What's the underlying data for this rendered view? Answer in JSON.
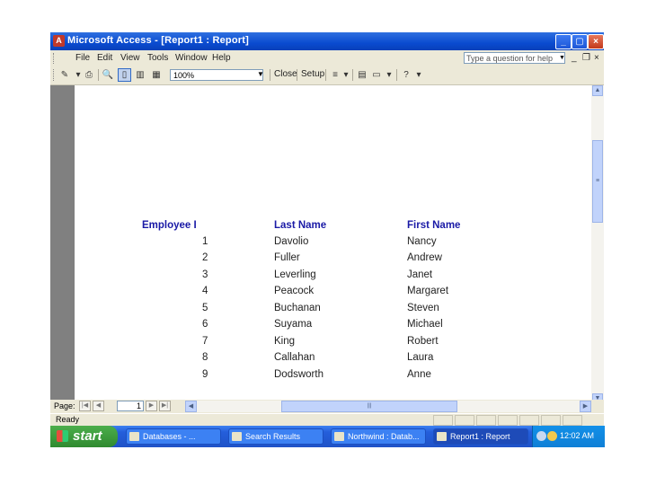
{
  "window": {
    "title": "Microsoft Access - [Report1 : Report]",
    "app_icon": "A"
  },
  "menu": {
    "items": [
      "File",
      "Edit",
      "View",
      "Tools",
      "Window",
      "Help"
    ],
    "question_placeholder": "Type a question for help",
    "mdi_min": "_",
    "mdi_restore": "❐",
    "mdi_close": "×"
  },
  "toolbar": {
    "zoom": "100%",
    "close_label": "Close",
    "setup_label": "Setup"
  },
  "report": {
    "headers": [
      "Employee I",
      "Last Name",
      "First Name"
    ],
    "rows": [
      {
        "id": "1",
        "last": "Davolio",
        "first": "Nancy"
      },
      {
        "id": "2",
        "last": "Fuller",
        "first": "Andrew"
      },
      {
        "id": "3",
        "last": "Leverling",
        "first": "Janet"
      },
      {
        "id": "4",
        "last": "Peacock",
        "first": "Margaret"
      },
      {
        "id": "5",
        "last": "Buchanan",
        "first": "Steven"
      },
      {
        "id": "6",
        "last": "Suyama",
        "first": "Michael"
      },
      {
        "id": "7",
        "last": "King",
        "first": "Robert"
      },
      {
        "id": "8",
        "last": "Callahan",
        "first": "Laura"
      },
      {
        "id": "9",
        "last": "Dodsworth",
        "first": "Anne"
      }
    ]
  },
  "navigation": {
    "page_label": "Page:",
    "page_number": "1"
  },
  "status": {
    "text": "Ready"
  },
  "taskbar": {
    "start_label": "start",
    "tasks": [
      "Databases - ...",
      "Search Results",
      "Northwind : Datab...",
      "Report1 : Report"
    ],
    "clock": "12:02 AM"
  },
  "colors": {
    "titlebar": "#0a4bd0",
    "header_text": "#1a1aa6",
    "workspace": "#808080",
    "taskbar": "#245edb"
  }
}
